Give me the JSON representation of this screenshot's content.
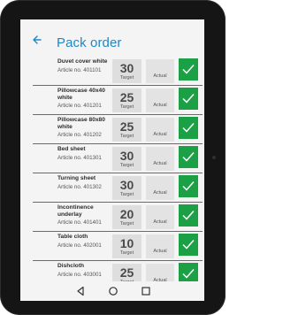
{
  "header": {
    "title": "Pack order",
    "back_icon": "arrow-left-icon"
  },
  "columns": {
    "target_label": "Target",
    "actual_label": "Actual"
  },
  "items": [
    {
      "name": "Duvet cover white",
      "article": "Article no. 401101",
      "target": "30",
      "actual": "",
      "done": true
    },
    {
      "name": "Pillowcase 40x40 white",
      "article": "Article no. 401201",
      "target": "25",
      "actual": "",
      "done": true
    },
    {
      "name": "Pillowcase 80x80 white",
      "article": "Article no. 401202",
      "target": "25",
      "actual": "",
      "done": true
    },
    {
      "name": "Bed sheet",
      "article": "Article no. 401301",
      "target": "30",
      "actual": "",
      "done": true
    },
    {
      "name": "Turning sheet",
      "article": "Article no. 401302",
      "target": "30",
      "actual": "",
      "done": true
    },
    {
      "name": "Incontinence underlay",
      "article": "Article no. 401401",
      "target": "20",
      "actual": "",
      "done": true
    },
    {
      "name": "Table cloth",
      "article": "Article no. 402001",
      "target": "10",
      "actual": "",
      "done": true
    },
    {
      "name": "Dishcloth",
      "article": "Article no. 403001",
      "target": "25",
      "actual": "",
      "done": true
    }
  ],
  "nav": {
    "back": "triangle-back-icon",
    "home": "circle-home-icon",
    "recents": "square-recents-icon"
  },
  "colors": {
    "accent": "#1e88c7",
    "check": "#1ba046"
  }
}
